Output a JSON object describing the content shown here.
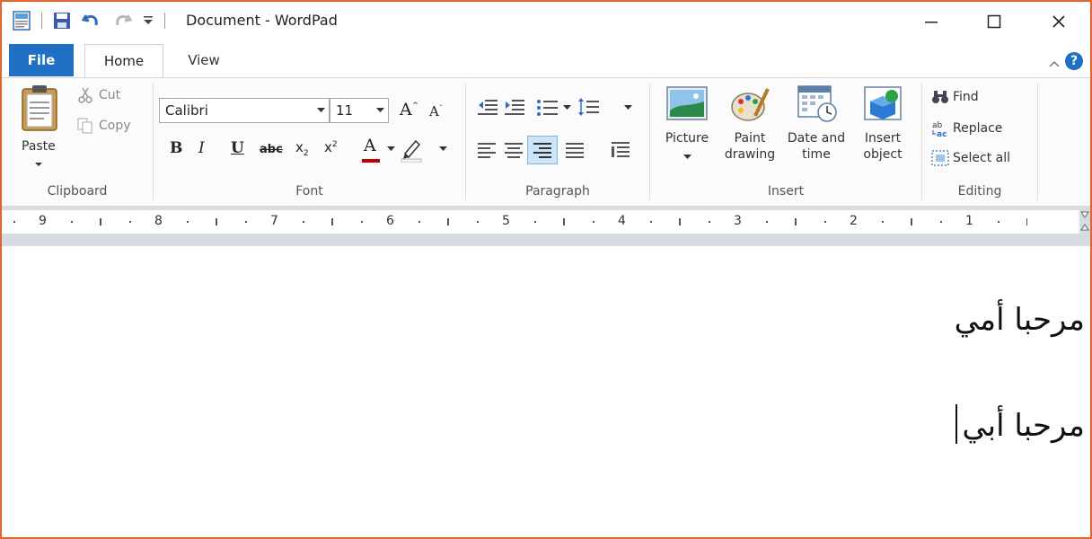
{
  "window": {
    "title": "Document - WordPad",
    "border_color": "#e0642f"
  },
  "tabs": {
    "file": "File",
    "home": "Home",
    "view": "View"
  },
  "clipboard": {
    "paste": "Paste",
    "cut": "Cut",
    "copy": "Copy",
    "label": "Clipboard"
  },
  "font": {
    "family": "Calibri",
    "size": "11",
    "label": "Font"
  },
  "paragraph": {
    "label": "Paragraph"
  },
  "insert": {
    "picture": "Picture",
    "paint_line1": "Paint",
    "paint_line2": "drawing",
    "date_line1": "Date and",
    "date_line2": "time",
    "object_line1": "Insert",
    "object_line2": "object",
    "label": "Insert"
  },
  "editing": {
    "find": "Find",
    "replace": "Replace",
    "select_all": "Select all",
    "label": "Editing"
  },
  "ruler": {
    "numbers": [
      "9",
      "8",
      "7",
      "6",
      "5",
      "4",
      "3",
      "2",
      "1"
    ]
  },
  "document": {
    "lines": [
      "مرحبا أمي",
      "مرحبا أبي"
    ]
  },
  "colors": {
    "accent": "#1f6fc4",
    "font_color_bar": "#c00000"
  }
}
